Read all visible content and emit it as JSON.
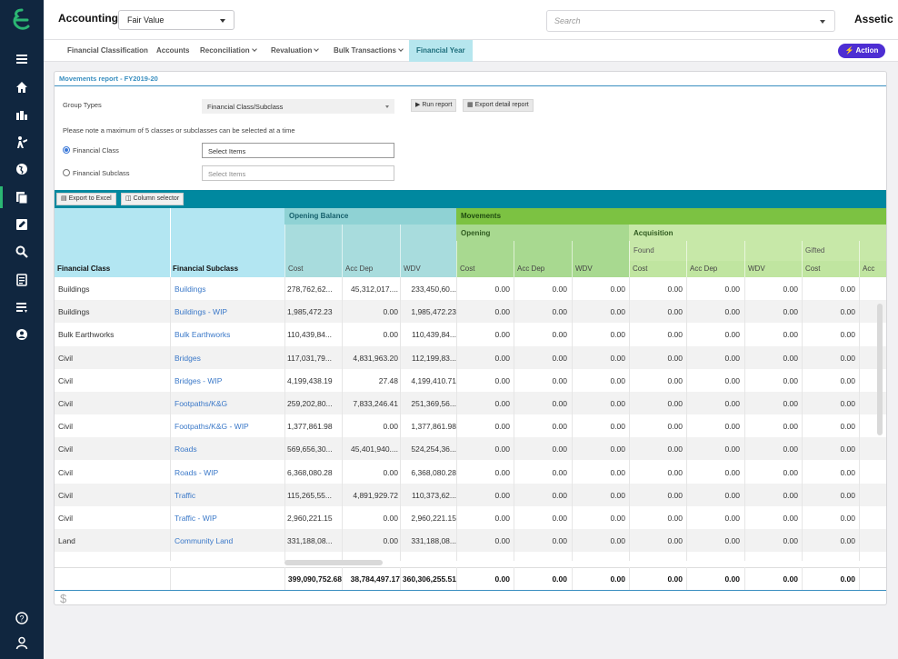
{
  "topbar": {
    "app_title": "Accounting",
    "view_select": "Fair Value",
    "search_placeholder": "Search",
    "brand": "Assetic"
  },
  "sidebar": {
    "icons": [
      "menu-icon",
      "home-icon",
      "dashboard-icon",
      "worker-icon",
      "globe-icon",
      "documents-icon",
      "edit-icon",
      "search-icon",
      "report-icon",
      "list-icon",
      "shield-icon",
      "help-icon",
      "user-icon"
    ]
  },
  "nav": {
    "items": [
      {
        "label": "Financial Classification",
        "has_menu": false
      },
      {
        "label": "Accounts",
        "has_menu": false
      },
      {
        "label": "Reconciliation",
        "has_menu": true
      },
      {
        "label": "Revaluation",
        "has_menu": true
      },
      {
        "label": "Bulk Transactions",
        "has_menu": true
      },
      {
        "label": "Financial Year",
        "has_menu": false,
        "active": true
      }
    ],
    "action_label": "Action"
  },
  "report": {
    "title": "Movements report - FY2019-20",
    "group_types_label": "Group Types",
    "group_types_value": "Financial Class/Subclass",
    "run_report": "Run report",
    "export_detail": "Export detail report",
    "note": "Please note a maximum of 5 classes or subclasses can be selected at a time",
    "radio_class": "Financial Class",
    "radio_subclass": "Financial Subclass",
    "select_class": "Select Items",
    "select_subclass": "Select Items"
  },
  "toolbar": {
    "export_excel": "Export to Excel",
    "column_selector": "Column selector"
  },
  "grid": {
    "group_opening_balance": "Opening Balance",
    "group_movements": "Movements",
    "sub_opening": "Opening",
    "sub_acquisition": "Acquisition",
    "sub_found": "Found",
    "sub_gifted": "Gifted",
    "col_class": "Financial Class",
    "col_subclass": "Financial Subclass",
    "col_cost": "Cost",
    "col_accdep": "Acc Dep",
    "col_wdv": "WDV",
    "col_acc_truncated": "Acc",
    "rows": [
      {
        "cls": "Buildings",
        "sub": "Buildings",
        "cost": "278,762,62...",
        "accdep": "45,312,017....",
        "wdv": "233,450,60..."
      },
      {
        "cls": "Buildings",
        "sub": "Buildings - WIP",
        "cost": "1,985,472.23",
        "accdep": "0.00",
        "wdv": "1,985,472.23"
      },
      {
        "cls": "Bulk Earthworks",
        "sub": "Bulk Earthworks",
        "cost": "110,439,84...",
        "accdep": "0.00",
        "wdv": "110,439,84..."
      },
      {
        "cls": "Civil",
        "sub": "Bridges",
        "cost": "117,031,79...",
        "accdep": "4,831,963.20",
        "wdv": "112,199,83..."
      },
      {
        "cls": "Civil",
        "sub": "Bridges - WIP",
        "cost": "4,199,438.19",
        "accdep": "27.48",
        "wdv": "4,199,410.71"
      },
      {
        "cls": "Civil",
        "sub": "Footpaths/K&G",
        "cost": "259,202,80...",
        "accdep": "7,833,246.41",
        "wdv": "251,369,56..."
      },
      {
        "cls": "Civil",
        "sub": "Footpaths/K&G - WIP",
        "cost": "1,377,861.98",
        "accdep": "0.00",
        "wdv": "1,377,861.98"
      },
      {
        "cls": "Civil",
        "sub": "Roads",
        "cost": "569,656,30...",
        "accdep": "45,401,940....",
        "wdv": "524,254,36..."
      },
      {
        "cls": "Civil",
        "sub": "Roads - WIP",
        "cost": "6,368,080.28",
        "accdep": "0.00",
        "wdv": "6,368,080.28"
      },
      {
        "cls": "Civil",
        "sub": "Traffic",
        "cost": "115,265,55...",
        "accdep": "4,891,929.72",
        "wdv": "110,373,62..."
      },
      {
        "cls": "Civil",
        "sub": "Traffic - WIP",
        "cost": "2,960,221.15",
        "accdep": "0.00",
        "wdv": "2,960,221.15"
      },
      {
        "cls": "Land",
        "sub": "Community Land",
        "cost": "331,188,08...",
        "accdep": "0.00",
        "wdv": "331,188,08..."
      }
    ],
    "zero": "0.00",
    "totals": {
      "cost": "399,090,752.68",
      "accdep": "38,784,497.17",
      "wdv": "360,306,255.51"
    },
    "footer_icon": "$"
  },
  "colors": {
    "sidebar": "#10263f",
    "accent_teal": "#00889f",
    "opening_balance_hdr": "#8dd3d5",
    "movements_hdr": "#7cc242",
    "action_btn": "#4d2ed3",
    "link": "#3a78c8"
  }
}
